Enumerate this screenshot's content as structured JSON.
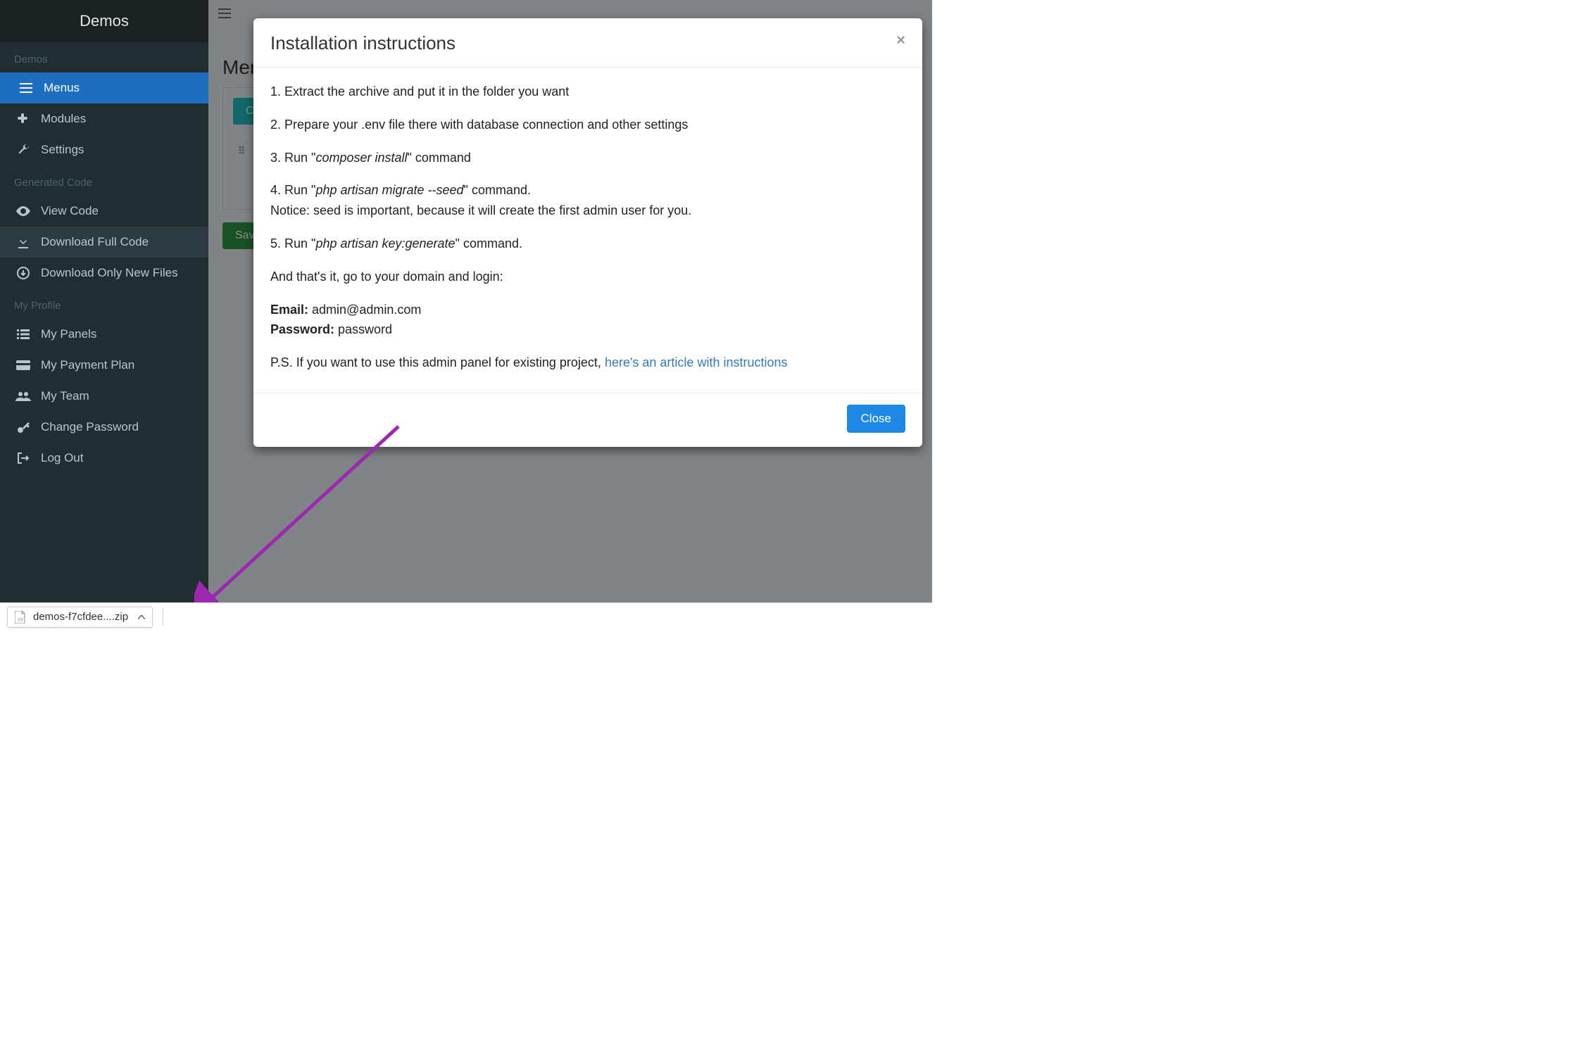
{
  "app_title": "Demos",
  "sidebar": {
    "demos_header": "Demos",
    "items_demos": [
      {
        "label": "Menus",
        "icon": "menu-icon",
        "active": true
      },
      {
        "label": "Modules",
        "icon": "puzzle-icon",
        "active": false
      },
      {
        "label": "Settings",
        "icon": "wrench-icon",
        "active": false
      }
    ],
    "gen_header": "Generated Code",
    "items_gen": [
      {
        "label": "View Code",
        "icon": "eye-icon"
      },
      {
        "label": "Download Full Code",
        "icon": "download-icon",
        "hover": true
      },
      {
        "label": "Download Only New Files",
        "icon": "download-circle-icon"
      }
    ],
    "profile_header": "My Profile",
    "items_profile": [
      {
        "label": "My Panels",
        "icon": "list-icon"
      },
      {
        "label": "My Payment Plan",
        "icon": "card-icon"
      },
      {
        "label": "My Team",
        "icon": "users-icon"
      },
      {
        "label": "Change Password",
        "icon": "key-icon"
      },
      {
        "label": "Log Out",
        "icon": "logout-icon"
      }
    ]
  },
  "page": {
    "title_partial": "Mer",
    "create_partial": "C",
    "save_partial": "Save"
  },
  "modal": {
    "title": "Installation instructions",
    "step1": "1. Extract the archive and put it in the folder you want",
    "step2": "2. Prepare your .env file there with database connection and other settings",
    "step3_a": "3. Run \"",
    "step3_cmd": "composer install",
    "step3_b": "\" command",
    "step4_a": "4. Run \"",
    "step4_cmd": "php artisan migrate --seed",
    "step4_b": "\" command.",
    "step4_notice": "Notice: seed is important, because it will create the first admin user for you.",
    "step5_a": "5. Run \"",
    "step5_cmd": "php artisan key:generate",
    "step5_b": "\" command.",
    "outro": "And that's it, go to your domain and login:",
    "email_label": "Email:",
    "email_value": " admin@admin.com",
    "password_label": "Password:",
    "password_value": " password",
    "ps_a": "P.S. If you want to use this admin panel for existing project, ",
    "ps_link": "here's an article with instructions",
    "close_label": "Close"
  },
  "download_chip": {
    "filename": "demos-f7cfdee....zip"
  }
}
